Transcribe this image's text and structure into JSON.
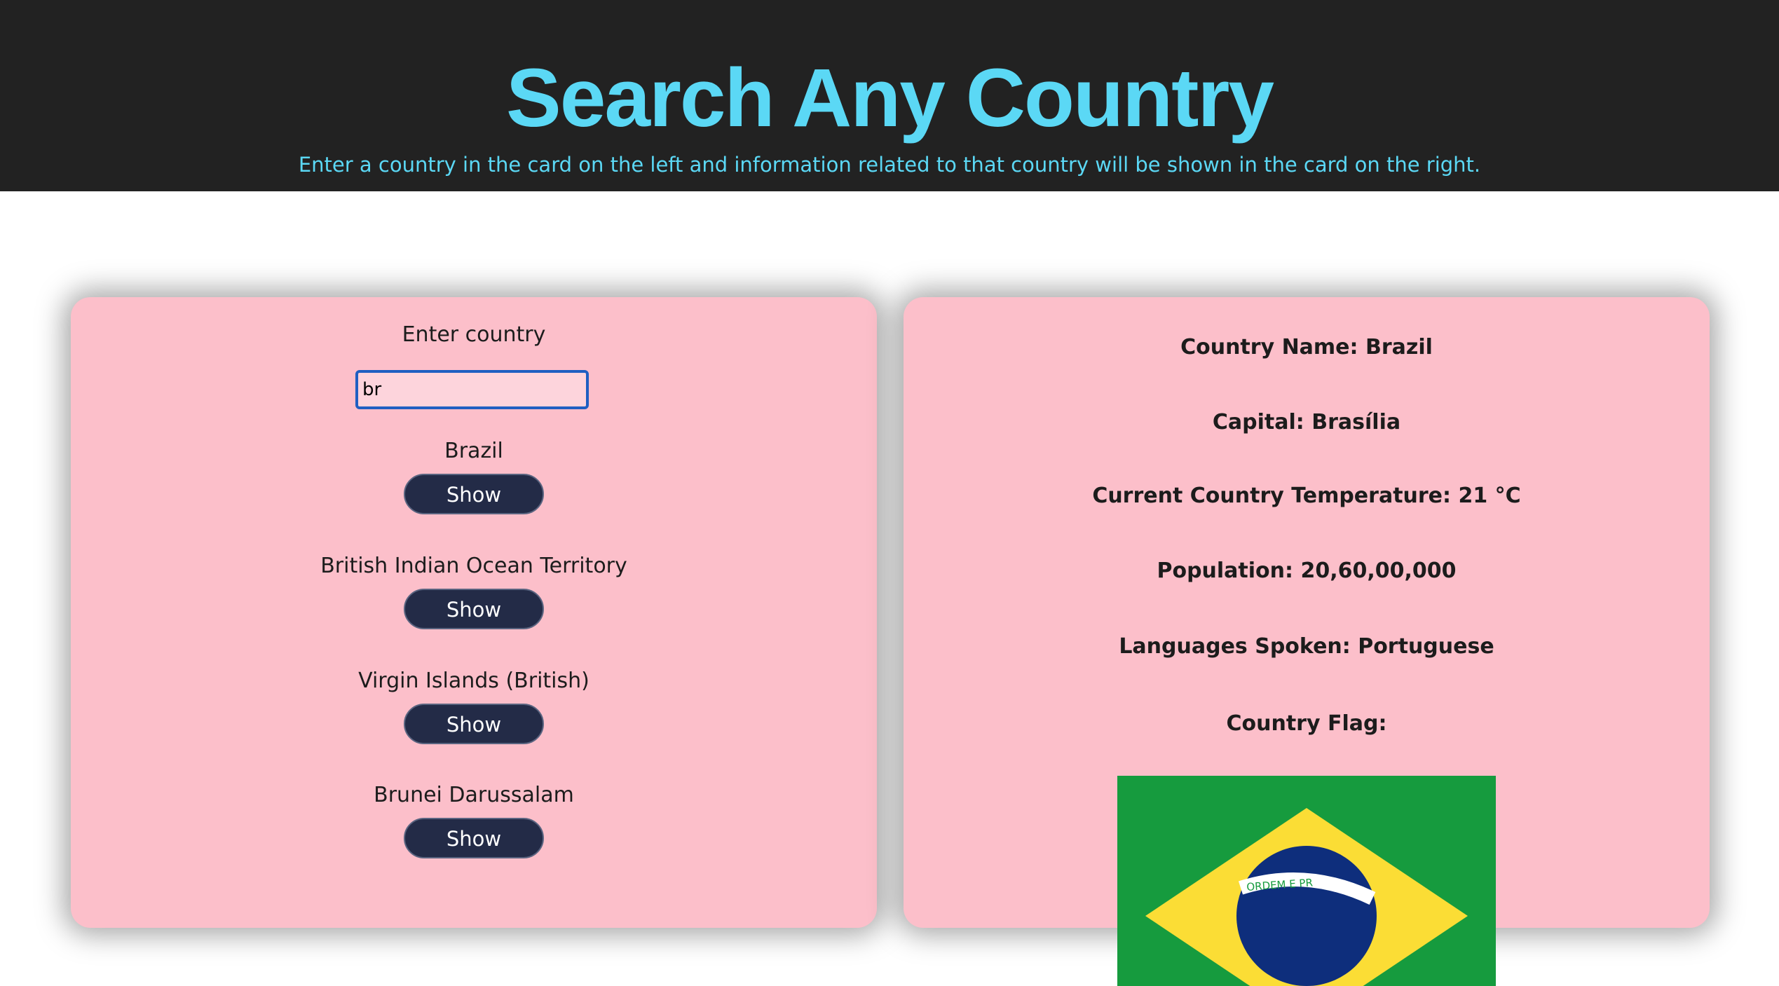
{
  "header": {
    "title": "Search Any Country",
    "subtitle": "Enter a country in the card on the left and information related to that country will be shown in the card on the right."
  },
  "search": {
    "label": "Enter country",
    "value": "br"
  },
  "results": [
    {
      "name": "Brazil",
      "button": "Show"
    },
    {
      "name": "British Indian Ocean Territory",
      "button": "Show"
    },
    {
      "name": "Virgin Islands (British)",
      "button": "Show"
    },
    {
      "name": "Brunei Darussalam",
      "button": "Show"
    }
  ],
  "info": {
    "country_name": "Country Name: Brazil",
    "capital": "Capital: Brasília",
    "temperature": "Current Country Temperature: 21 °C",
    "population": "Population: 20,60,00,000",
    "languages": "Languages Spoken: Portuguese",
    "flag_label": "Country Flag:"
  },
  "flag": {
    "motto_fragment": "ORDEM E PR",
    "green": "#169b3e",
    "yellow": "#fbdd35",
    "blue": "#0e2e7c"
  },
  "colors": {
    "header_bg": "#222222",
    "accent": "#5bd8f5",
    "card_bg": "#fcbfca",
    "button_bg": "#232b47"
  }
}
